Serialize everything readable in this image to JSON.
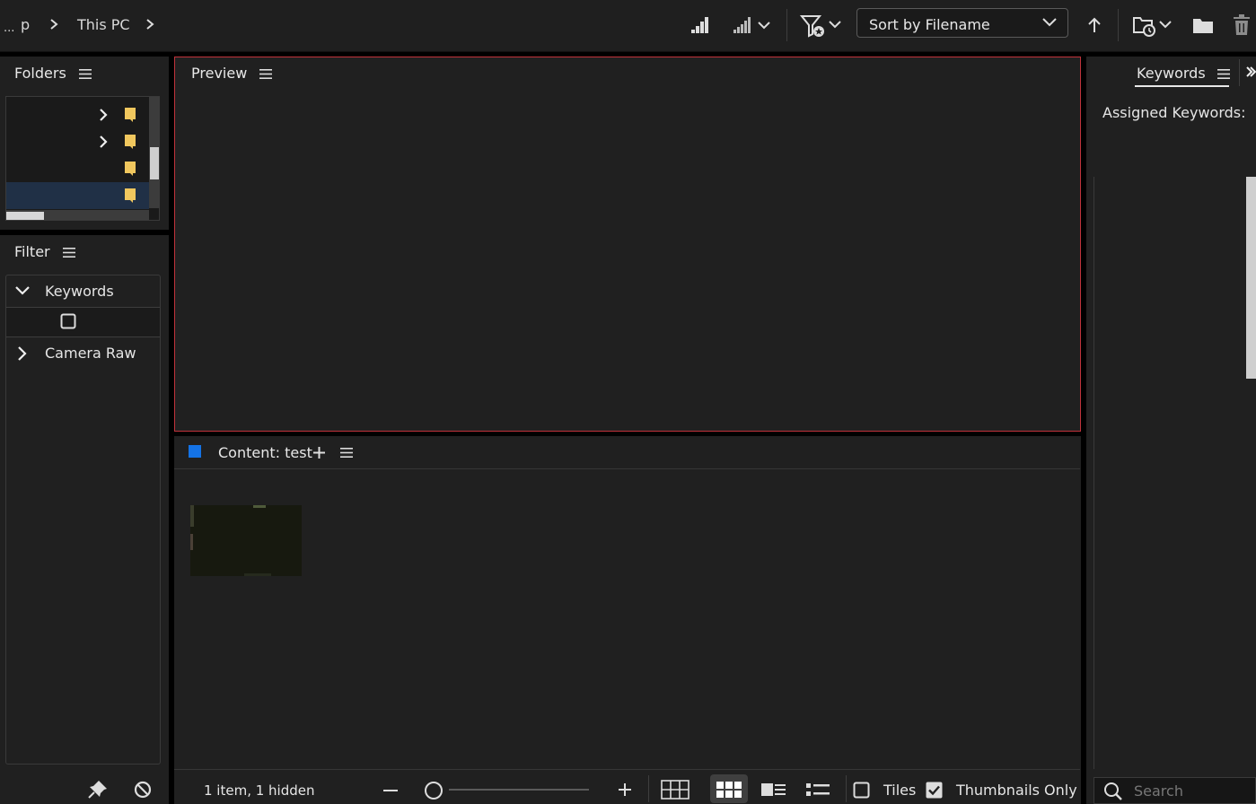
{
  "breadcrumb": {
    "items": [
      "p",
      "This PC"
    ],
    "overflow_label": "..."
  },
  "toolbar": {
    "sort_label": "Sort by Filename",
    "icons": [
      "quality-low-icon",
      "quality-high-dropdown-icon",
      "filter-rating-dropdown-icon",
      "sort-ascending-icon",
      "recent-folders-dropdown-icon",
      "new-folder-icon",
      "trash-icon"
    ]
  },
  "folders": {
    "title": "Folders",
    "rows": [
      {
        "expandable": true,
        "selected": false
      },
      {
        "expandable": true,
        "selected": false
      },
      {
        "expandable": false,
        "selected": false
      },
      {
        "expandable": false,
        "selected": true
      }
    ]
  },
  "filter": {
    "title": "Filter",
    "sections": [
      {
        "label": "Keywords",
        "expanded": true
      },
      {
        "label": "Camera Raw",
        "expanded": false
      }
    ]
  },
  "preview": {
    "title": "Preview"
  },
  "content": {
    "title": "Content: test",
    "status": "1 item, 1 hidden",
    "tiles_label": "Tiles",
    "tiles_checked": false,
    "thumbnails_only_label": "Thumbnails Only",
    "thumbnails_only_checked": true,
    "accent_color": "#1473e6"
  },
  "keywords": {
    "tab_label": "Keywords",
    "assigned_label": "Assigned Keywords:",
    "search_placeholder": "Search"
  }
}
